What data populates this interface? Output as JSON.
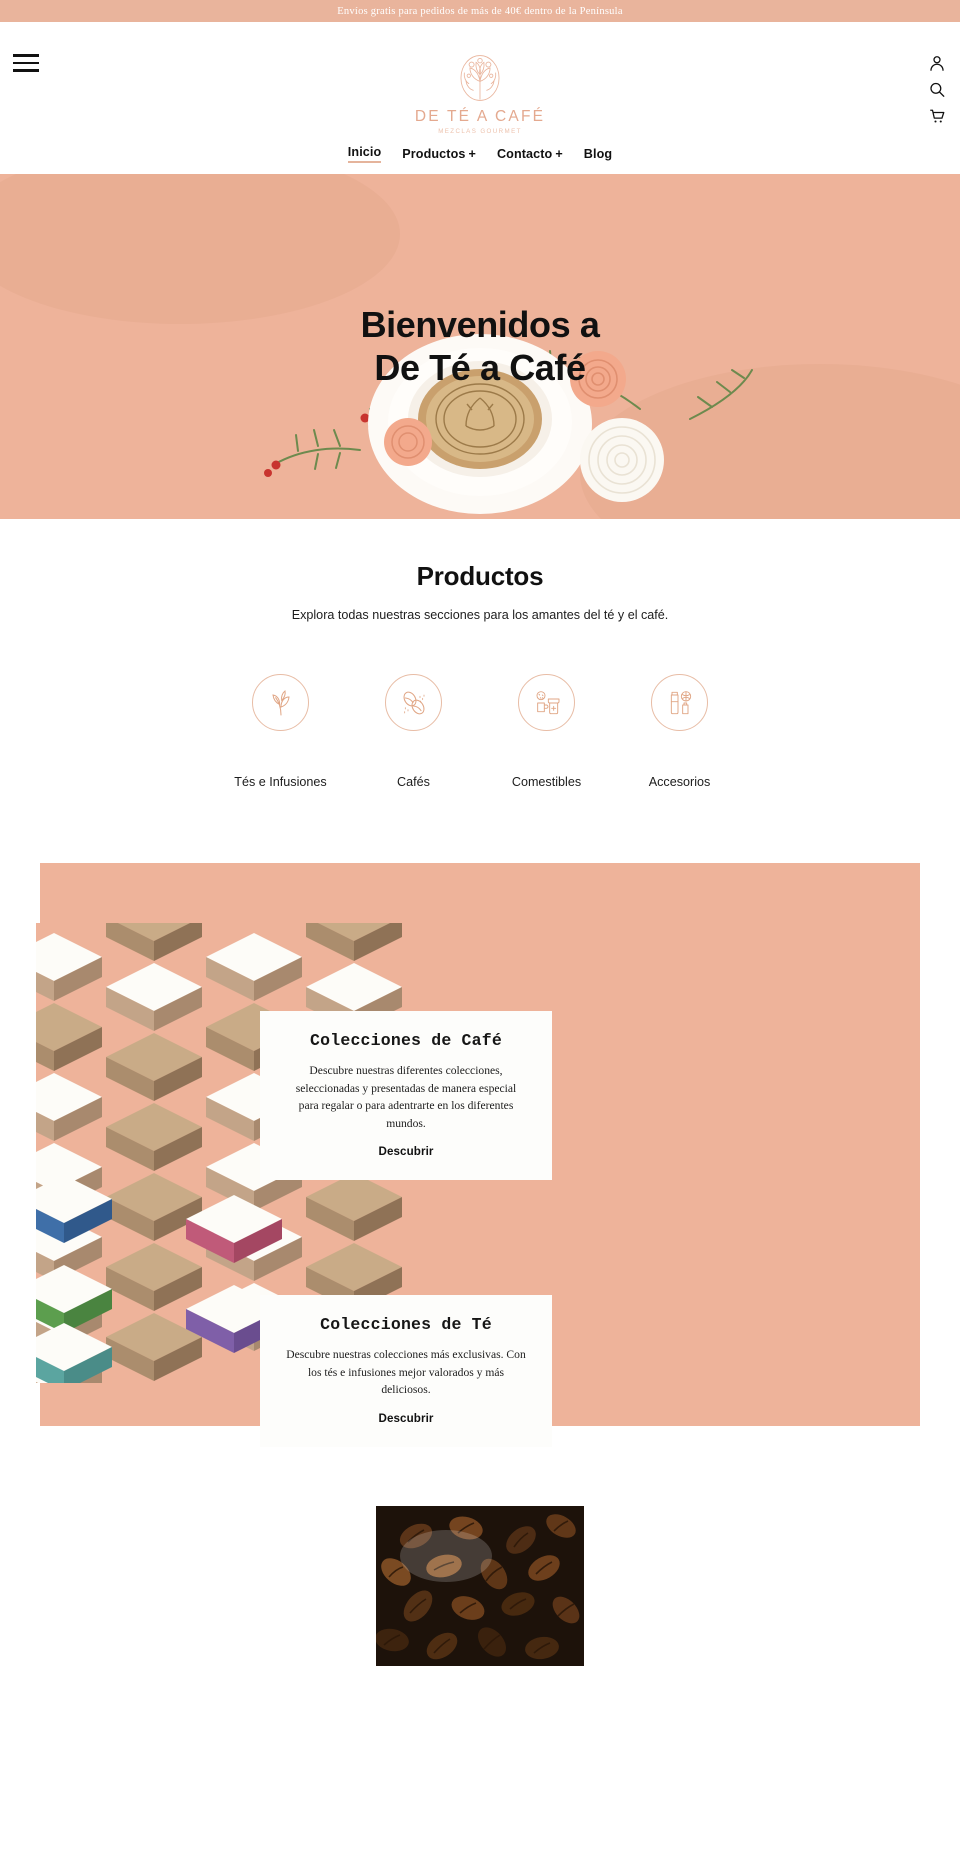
{
  "announcement": {
    "text": "Envíos gratis para pedidos de más de 40€ dentro de la Península"
  },
  "header": {
    "menu_icon": "hamburger-menu-icon",
    "logo": {
      "wordmark": "DE TÉ A CAFÉ",
      "tagline": "MEZCLAS GOURMET",
      "mark": "floral-circle-logo"
    },
    "utility_icons": [
      "account-icon",
      "search-icon",
      "cart-icon"
    ],
    "nav": [
      {
        "label": "Inicio",
        "active": true,
        "has_plus": false
      },
      {
        "label": "Productos",
        "active": false,
        "has_plus": true
      },
      {
        "label": "Contacto",
        "active": false,
        "has_plus": true
      },
      {
        "label": "Blog",
        "active": false,
        "has_plus": false
      }
    ]
  },
  "hero": {
    "title_line1": "Bienvenidos a",
    "title_line2": "De Té a Café",
    "background_color": "#eeb39a"
  },
  "products": {
    "heading": "Productos",
    "subheading": "Explora todas nuestras secciones para los amantes del té y el café.",
    "categories": [
      {
        "label": "Tés e Infusiones",
        "icon": "tea-leaf-icon"
      },
      {
        "label": "Cafés",
        "icon": "coffee-bean-icon"
      },
      {
        "label": "Comestibles",
        "icon": "jam-jar-icon"
      },
      {
        "label": "Accesorios",
        "icon": "thermos-bottle-icon"
      }
    ]
  },
  "collections": {
    "band_color": "#eeb39a",
    "cards": [
      {
        "title": "Colecciones de Café",
        "body": "Descubre nuestras diferentes colecciones, seleccionadas y presentadas de manera especial para regalar o para adentrarte en los diferentes mundos.",
        "cta": "Descubrir"
      },
      {
        "title": "Colecciones de Té",
        "body": "Descubre nuestras colecciones más exclusivas. Con los tés e infusiones mejor valorados y más deliciosos.",
        "cta": "Descubrir"
      }
    ]
  },
  "colors": {
    "accent": "#e9b49c",
    "hero": "#eeb39a",
    "logo": "#e4a98f",
    "text": "#111111"
  }
}
